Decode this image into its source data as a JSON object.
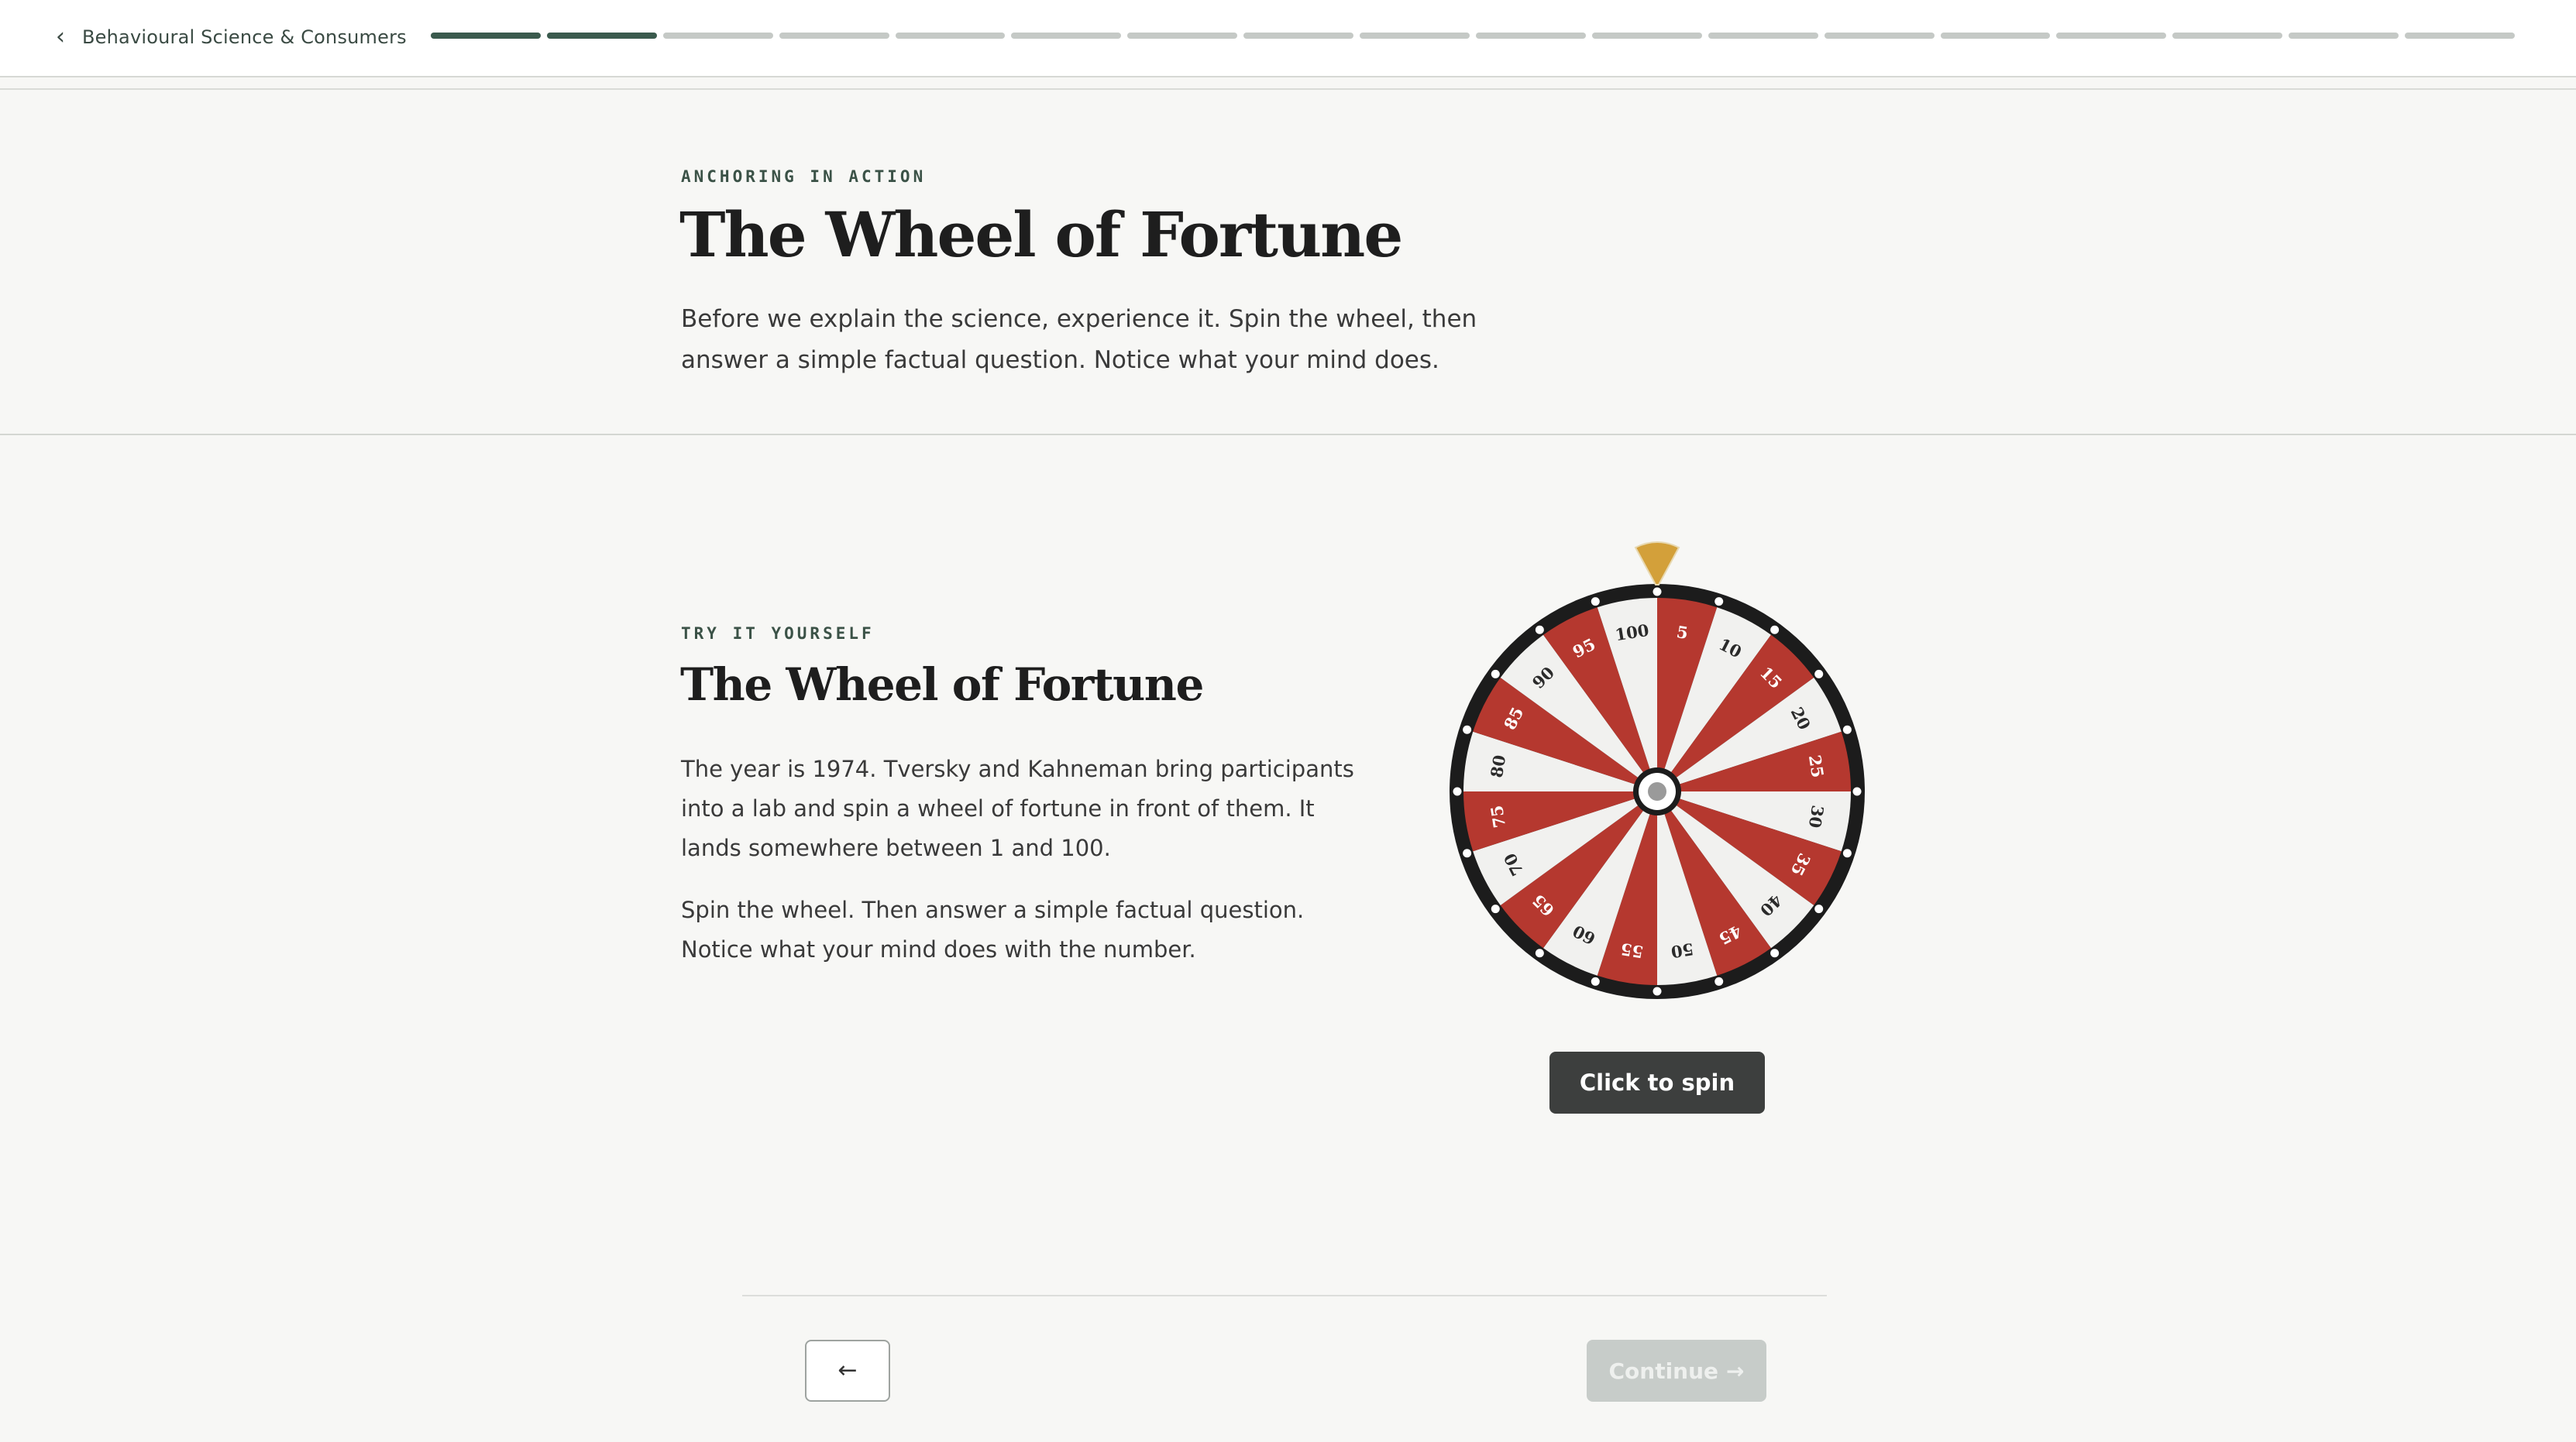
{
  "header": {
    "back_chevron": "‹",
    "course_title": "Behavioural Science & Consumers",
    "progress": {
      "completed": 2,
      "total": 18
    }
  },
  "intro": {
    "eyebrow": "ANCHORING IN ACTION",
    "title": "The Wheel of Fortune",
    "lead": "Before we explain the science, experience it. Spin the wheel, then answer a simple factual question. Notice what your mind does."
  },
  "activity": {
    "eyebrow": "TRY IT YOURSELF",
    "title": "The Wheel of Fortune",
    "paragraph_1": "The year is 1974. Tversky and Kahneman bring participants into a lab and spin a wheel of fortune in front of them. It lands somewhere between 1 and 100.",
    "paragraph_2": "Spin the wheel. Then answer a simple factual question. Notice what your mind does with the number.",
    "wheel": {
      "numbers": [
        "5",
        "10",
        "15",
        "20",
        "25",
        "30",
        "35",
        "40",
        "45",
        "50",
        "55",
        "60",
        "65",
        "70",
        "75",
        "80",
        "85",
        "90",
        "95",
        "100"
      ],
      "colors": {
        "red": "#b5382f",
        "white": "#f1f1ef",
        "rim": "#1c1c1c",
        "pointer": "#d3a03a",
        "hub": "#9a9a9a"
      }
    },
    "spin_label": "Click to spin"
  },
  "footer": {
    "back_arrow": "←",
    "continue_label": "Continue",
    "continue_arrow": "→"
  }
}
